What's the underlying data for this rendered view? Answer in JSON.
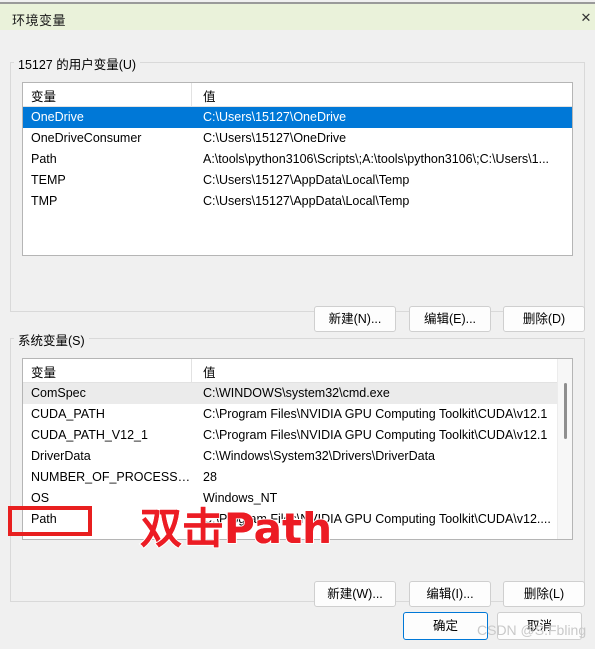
{
  "window": {
    "title": "环境变量",
    "close_icon": "✕"
  },
  "user_section": {
    "label": "15127 的用户变量(U)",
    "columns": [
      "变量",
      "值"
    ],
    "rows": [
      {
        "name": "OneDrive",
        "value": "C:\\Users\\15127\\OneDrive",
        "state": "selected"
      },
      {
        "name": "OneDriveConsumer",
        "value": "C:\\Users\\15127\\OneDrive",
        "state": "normal"
      },
      {
        "name": "Path",
        "value": "A:\\tools\\python3106\\Scripts\\;A:\\tools\\python3106\\;C:\\Users\\1...",
        "state": "normal"
      },
      {
        "name": "TEMP",
        "value": "C:\\Users\\15127\\AppData\\Local\\Temp",
        "state": "normal"
      },
      {
        "name": "TMP",
        "value": "C:\\Users\\15127\\AppData\\Local\\Temp",
        "state": "normal"
      }
    ],
    "buttons": {
      "new": "新建(N)...",
      "edit": "编辑(E)...",
      "delete": "删除(D)"
    }
  },
  "system_section": {
    "label": "系统变量(S)",
    "columns": [
      "变量",
      "值"
    ],
    "rows": [
      {
        "name": "ComSpec",
        "value": "C:\\WINDOWS\\system32\\cmd.exe",
        "state": "hover"
      },
      {
        "name": "CUDA_PATH",
        "value": "C:\\Program Files\\NVIDIA GPU Computing Toolkit\\CUDA\\v12.1",
        "state": "normal"
      },
      {
        "name": "CUDA_PATH_V12_1",
        "value": "C:\\Program Files\\NVIDIA GPU Computing Toolkit\\CUDA\\v12.1",
        "state": "normal"
      },
      {
        "name": "DriverData",
        "value": "C:\\Windows\\System32\\Drivers\\DriverData",
        "state": "normal"
      },
      {
        "name": "NUMBER_OF_PROCESSORS",
        "value": "28",
        "state": "normal"
      },
      {
        "name": "OS",
        "value": "Windows_NT",
        "state": "normal"
      },
      {
        "name": "Path",
        "value": "C:\\Program Files\\NVIDIA GPU Computing Toolkit\\CUDA\\v12....",
        "state": "normal"
      }
    ],
    "buttons": {
      "new": "新建(W)...",
      "edit": "编辑(I)...",
      "delete": "删除(L)"
    }
  },
  "footer": {
    "ok": "确定",
    "cancel": "取消"
  },
  "annotation": {
    "text": "双击Path",
    "color": "#ec1c24"
  },
  "watermark": {
    "text": "CSDN @S.Fbling"
  }
}
